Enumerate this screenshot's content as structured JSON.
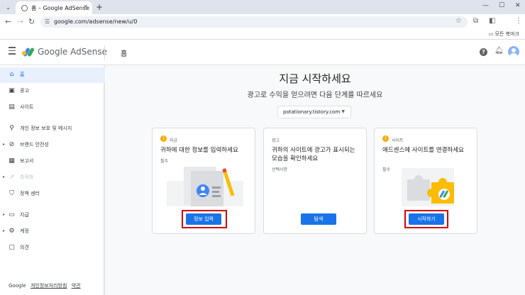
{
  "browser": {
    "tab_title": "홈 – Google AdSense",
    "url": "google.com/adsense/new/u/0",
    "bookmarks_all": "모든 북마크",
    "colors": {
      "chrome_bg": "#dfe3eb",
      "accent": "#1a73e8"
    }
  },
  "app": {
    "brand": "Google AdSense",
    "page_title": "홈"
  },
  "sidebar": {
    "items": [
      {
        "label": "홈",
        "icon": "home-icon",
        "active": true
      },
      {
        "label": "광고",
        "icon": "ads-icon"
      },
      {
        "label": "사이트",
        "icon": "sites-icon"
      },
      {
        "label": "개인 정보 보호 및 메시지",
        "icon": "privacy-icon"
      },
      {
        "label": "브랜드 안전성",
        "icon": "block-icon"
      },
      {
        "label": "보고서",
        "icon": "report-icon"
      },
      {
        "label": "최적화",
        "icon": "trending-icon",
        "disabled": true
      },
      {
        "label": "정책 센터",
        "icon": "shield-icon"
      },
      {
        "label": "지급",
        "icon": "payments-icon"
      },
      {
        "label": "계정",
        "icon": "gear-icon"
      },
      {
        "label": "의견",
        "icon": "feedback-icon"
      }
    ],
    "footer": {
      "google": "Google",
      "privacy": "개인정보처리방침",
      "terms": "약관"
    }
  },
  "main": {
    "title": "지금 시작하세요",
    "subtitle": "광고로 수익을 얻으려면 다음 단계를 따르세요",
    "site": "potationary.tistory.com",
    "cards": [
      {
        "tag": "지금",
        "title": "귀하에 대한 정보를 입력하세요",
        "note": "필수",
        "button": "정보 입력"
      },
      {
        "tag": "광고",
        "title": "귀하의 사이트에 광고가 표시되는 모습을 확인하세요",
        "note": "선택사항",
        "button": "탐색"
      },
      {
        "tag": "사이트",
        "title": "애드센스에 사이트를 연결하세요",
        "note": "필수",
        "button": "시작하기"
      }
    ]
  }
}
